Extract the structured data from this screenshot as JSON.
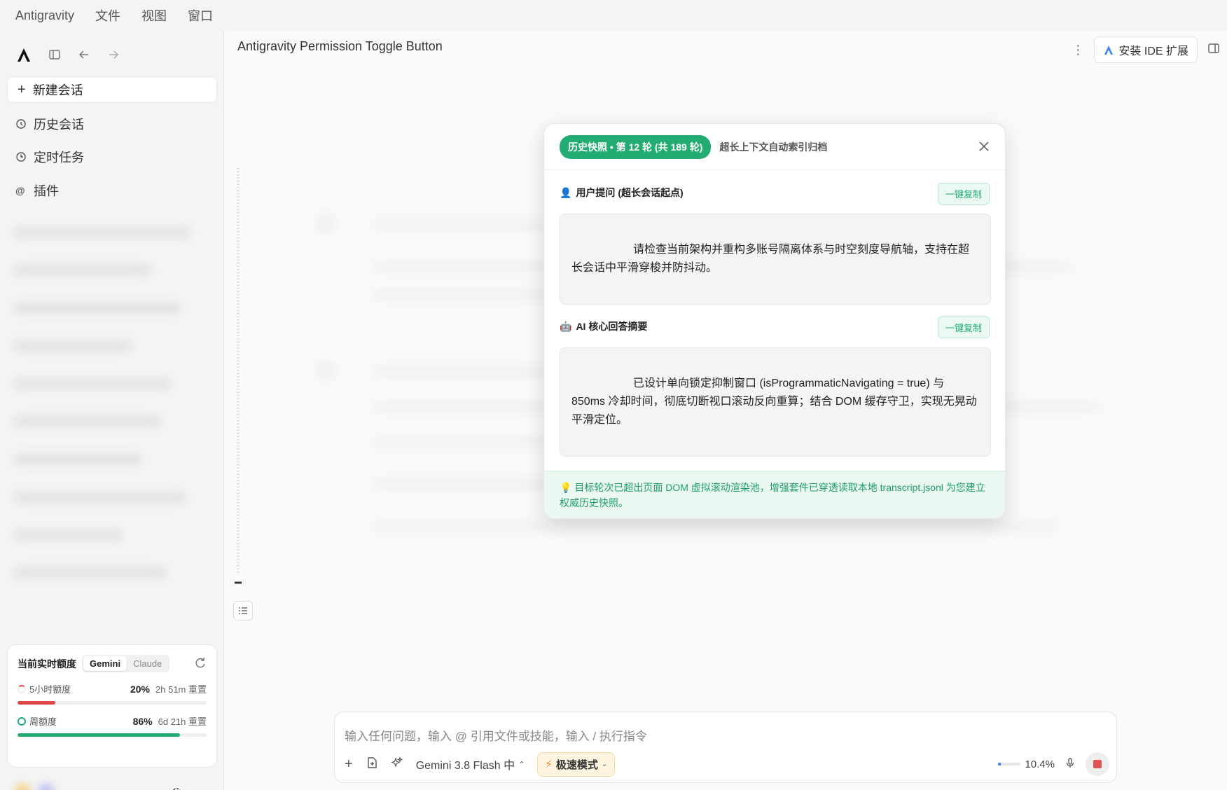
{
  "menu": [
    "Antigravity",
    "文件",
    "视图",
    "窗口"
  ],
  "sidebar": {
    "new_chat": "新建会话",
    "items": [
      {
        "label": "历史会话",
        "icon": "history-icon"
      },
      {
        "label": "定时任务",
        "icon": "clock-icon"
      },
      {
        "label": "插件",
        "icon": "at-icon"
      }
    ]
  },
  "quota": {
    "title": "当前实时额度",
    "tabs": [
      "Gemini",
      "Claude"
    ],
    "active_tab": "Gemini",
    "rows": [
      {
        "label": "5小时额度",
        "percent": "20%",
        "reset": "2h 51m 重置",
        "fill": 0.2,
        "color": "#e34848"
      },
      {
        "label": "周额度",
        "percent": "86%",
        "reset": "6d 21h 重置",
        "fill": 0.86,
        "color": "#22ac72"
      }
    ]
  },
  "settings_label": "设置",
  "main": {
    "title": "Antigravity Permission Toggle Button",
    "ide_button": "安装 IDE 扩展"
  },
  "modal": {
    "badge": "历史快照 • 第 12 轮 (共 189 轮)",
    "subtitle": "超长上下文自动索引归档",
    "user_heading": "用户提问 (超长会话起点)",
    "copy_label": "一键复制",
    "user_text": "请检查当前架构并重构多账号隔离体系与时空刻度导航轴，支持在超长会话中平滑穿梭并防抖动。",
    "ai_heading": "AI 核心回答摘要",
    "ai_text": "已设计单向锁定抑制窗口 (isProgrammaticNavigating = true) 与 850ms 冷却时间，彻底切断视口滚动反向重算；结合 DOM 缓存守卫，实现无晃动平滑定位。",
    "tip": "目标轮次已超出页面 DOM 虚拟滚动渲染池，增强套件已穿透读取本地 transcript.jsonl 为您建立权威历史快照。"
  },
  "input": {
    "placeholder": "输入任何问题，输入 @ 引用文件或技能，输入 / 执行指令",
    "model": "Gemini 3.8 Flash 中",
    "speed_mode": "极速模式",
    "context_percent": "10.4%",
    "context_fill": 0.104
  }
}
